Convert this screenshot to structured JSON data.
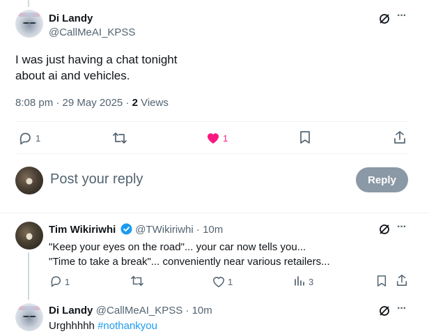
{
  "main_tweet": {
    "author_name": "Di Landy",
    "author_handle": "@CallMeAI_KPSS",
    "body_line1": "I was just having a chat tonight",
    "body_line2": "about ai and vehicles.",
    "timestamp": "8:08 pm · 29 May 2025 · ",
    "views_count": "2",
    "views_label": " Views",
    "reply_count": "1",
    "like_count": "1",
    "more": "···"
  },
  "composer": {
    "placeholder": "Post your reply",
    "reply_button": "Reply"
  },
  "replies": [
    {
      "author_name": "Tim Wikiriwhi",
      "author_handle": "@TWikiriwhi",
      "time": " · 10m",
      "line1": "\"Keep your eyes on the road\"... your car now tells you...",
      "line2": "\"Time to take a break\"... conveniently near various retailers...",
      "reply_count": "1",
      "like_count": "1",
      "views_count": "3",
      "more": "···"
    },
    {
      "author_name": "Di Landy",
      "author_handle": "@CallMeAI_KPSS",
      "time": " · 10m",
      "text": "Urghhhhh ",
      "hashtag": "#nothankyou",
      "more": "···"
    }
  ],
  "colors": {
    "like_pink": "#f91880",
    "verified_blue": "#1d9bf0",
    "icon_grey": "#536471"
  }
}
